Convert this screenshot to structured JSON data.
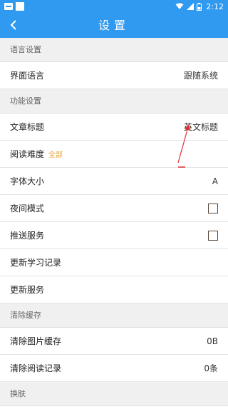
{
  "status_bar": {
    "time": "2:12"
  },
  "app_bar": {
    "title": "设置",
    "back_icon": "chevron-left-icon"
  },
  "sections": {
    "language": {
      "header": "语言设置",
      "ui_language": {
        "label": "界面语言",
        "value": "跟随系统"
      }
    },
    "features": {
      "header": "功能设置",
      "article_title": {
        "label": "文章标题",
        "value": "英文标题"
      },
      "reading_difficulty": {
        "label": "阅读难度",
        "tag": "全部"
      },
      "font_size": {
        "label": "字体大小",
        "value": "A"
      },
      "night_mode": {
        "label": "夜间模式",
        "checked": false
      },
      "push_service": {
        "label": "推送服务",
        "checked": false
      },
      "update_study_record": {
        "label": "更新学习记录"
      },
      "update_service": {
        "label": "更新服务"
      }
    },
    "cache": {
      "header": "清除缓存",
      "clear_image_cache": {
        "label": "清除图片缓存",
        "value": "0B"
      },
      "clear_reading_record": {
        "label": "清除阅读记录",
        "value": "0条"
      }
    },
    "skin": {
      "header": "换肤"
    }
  },
  "colors": {
    "primary": "#2f9af0",
    "accent_tag": "#e8a43a",
    "annotation": "#e03030"
  }
}
